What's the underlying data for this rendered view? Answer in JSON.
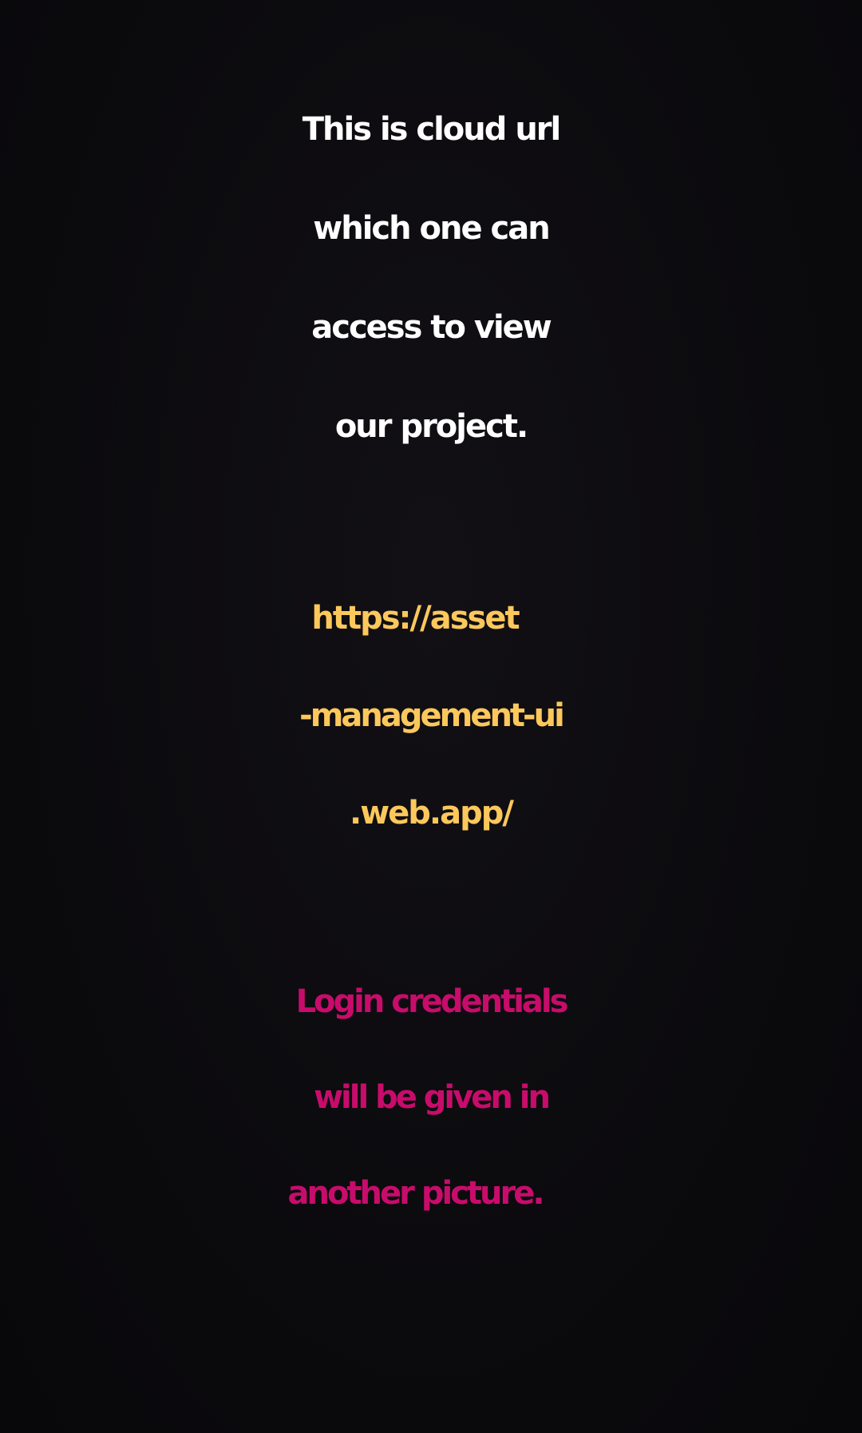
{
  "intro": {
    "lines": [
      "This is cloud url",
      "which one can",
      "access to view",
      "our project."
    ]
  },
  "url": {
    "lines": [
      "https://asset",
      "-management-ui",
      ".web.app/"
    ]
  },
  "note": {
    "lines": [
      "Login credentials",
      "will be given in",
      "another picture."
    ]
  },
  "colors": {
    "background": "#0b0a0d",
    "intro_text": "#ffffff",
    "url_text": "#fcc85c",
    "note_text": "#c80c6b"
  }
}
